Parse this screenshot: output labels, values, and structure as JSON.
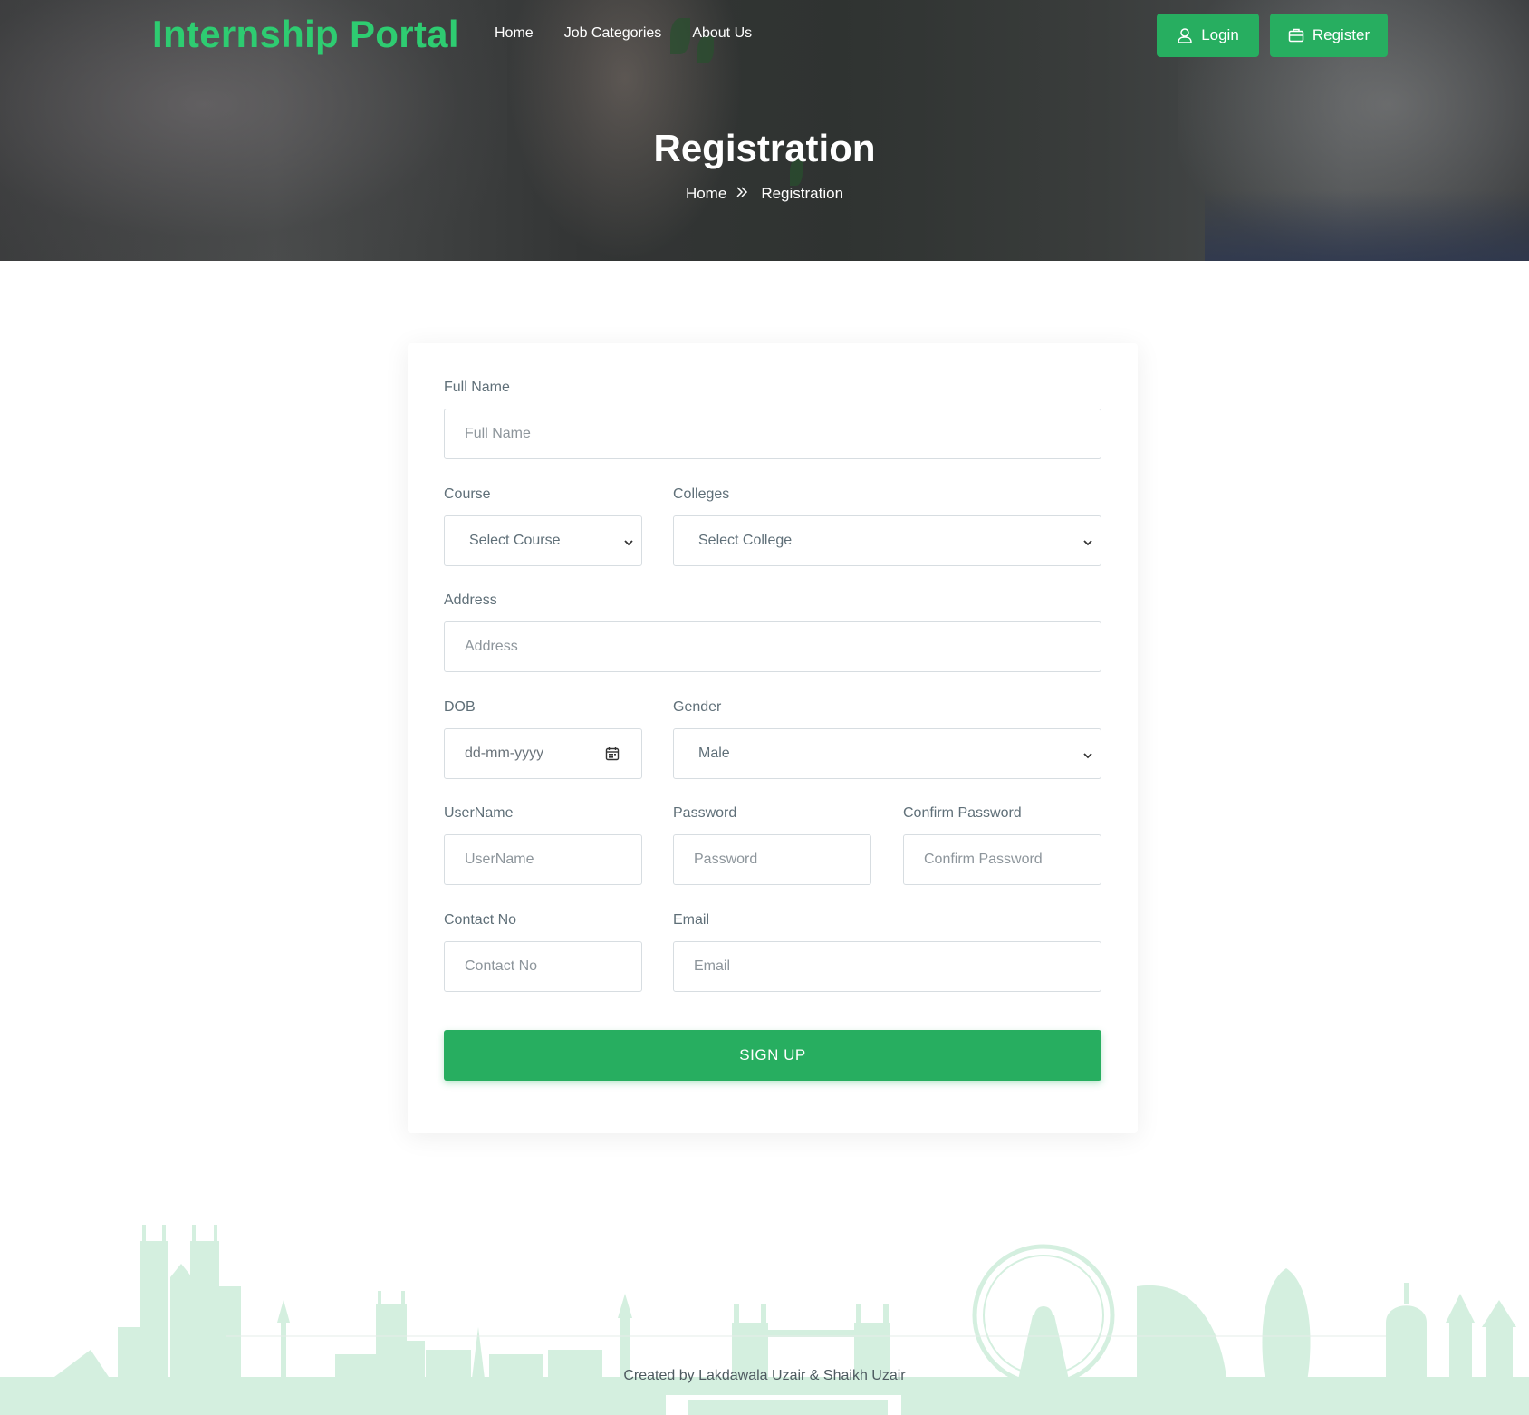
{
  "header": {
    "brand": "Internship Portal",
    "nav": [
      "Home",
      "Job Categories",
      "About Us"
    ],
    "login_label": "Login",
    "register_label": "Register",
    "accent_color": "#27ae60",
    "brand_color": "#2ecc71"
  },
  "hero": {
    "title": "Registration",
    "breadcrumb": [
      "Home",
      "Registration"
    ]
  },
  "form": {
    "full_name": {
      "label": "Full Name",
      "placeholder": "Full Name"
    },
    "course": {
      "label": "Course",
      "selected": "Select Course"
    },
    "colleges": {
      "label": "Colleges",
      "selected": "Select College"
    },
    "address": {
      "label": "Address",
      "placeholder": "Address"
    },
    "dob": {
      "label": "DOB",
      "placeholder": "dd-mm-yyyy"
    },
    "gender": {
      "label": "Gender",
      "selected": "Male"
    },
    "username": {
      "label": "UserName",
      "placeholder": "UserName"
    },
    "password": {
      "label": "Password",
      "placeholder": "Password"
    },
    "confirm_password": {
      "label": "Confirm Password",
      "placeholder": "Confirm Password"
    },
    "contact_no": {
      "label": "Contact No",
      "placeholder": "Contact No"
    },
    "email": {
      "label": "Email",
      "placeholder": "Email"
    },
    "submit_label": "SIGN UP"
  },
  "footer": {
    "credit": "Created by Lakdawala Uzair & Shaikh Uzair"
  }
}
